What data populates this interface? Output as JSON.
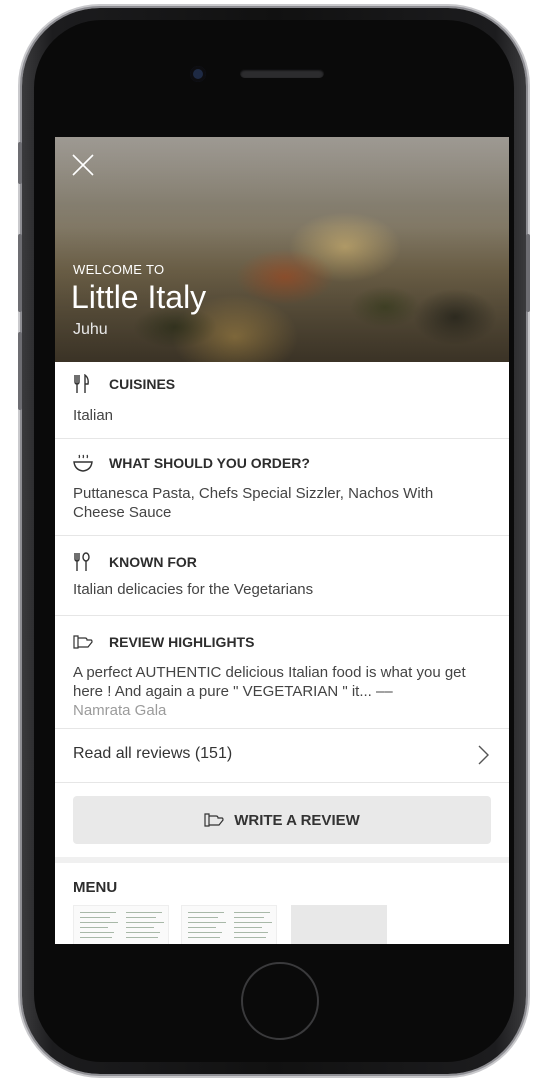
{
  "restaurant": {
    "welcome_label": "WELCOME TO",
    "name": "Little Italy",
    "locality": "Juhu"
  },
  "sections": {
    "cuisines": {
      "title": "CUISINES",
      "icon": "fork-knife-icon",
      "body": "Italian"
    },
    "what_to_order": {
      "title": "WHAT SHOULD YOU ORDER?",
      "icon": "steaming-bowl-icon",
      "body": "Puttanesca Pasta, Chefs Special Sizzler, Nachos With Cheese Sauce"
    },
    "known_for": {
      "title": "KNOWN FOR",
      "icon": "fork-spoon-icon",
      "body": "Italian delicacies for the Vegetarians"
    },
    "review_highlights": {
      "title": "REVIEW HIGHLIGHTS",
      "icon": "review-hand-icon",
      "body": "A perfect AUTHENTIC delicious Italian food is what you get here ! And again a pure \" VEGETARIAN \" it... ––",
      "author": "Namrata Gala"
    }
  },
  "reviews": {
    "read_all_label": "Read all reviews (151)",
    "write_review_label": "WRITE A REVIEW"
  },
  "menu": {
    "title": "MENU"
  },
  "colors": {
    "text_dark": "#2d2d2d",
    "button_bg": "#e9e9e9",
    "divider": "#e6e6e6"
  }
}
